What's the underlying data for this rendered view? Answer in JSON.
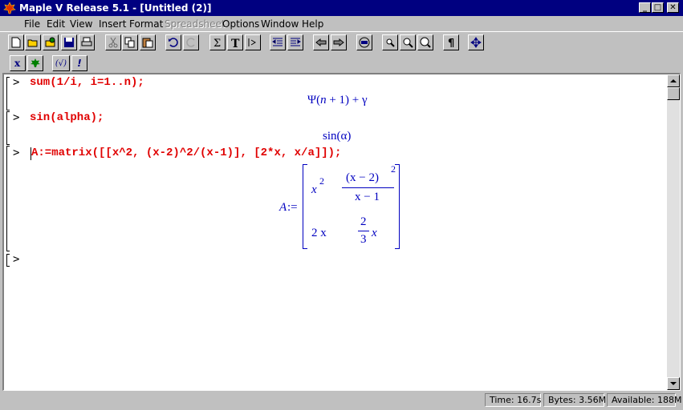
{
  "window": {
    "title": "Maple V Release 5.1 - [Untitled (2)]"
  },
  "menu": [
    {
      "label": "File",
      "disabled": false
    },
    {
      "label": "Edit",
      "disabled": false
    },
    {
      "label": "View",
      "disabled": false
    },
    {
      "label": "Insert",
      "disabled": false
    },
    {
      "label": "Format",
      "disabled": false
    },
    {
      "label": "Spreadsheet",
      "disabled": true
    },
    {
      "label": "Options",
      "disabled": false
    },
    {
      "label": "Window",
      "disabled": false
    },
    {
      "label": "Help",
      "disabled": false
    }
  ],
  "toolbar2": {
    "sqrt_label": "(√)",
    "exec_label": "!"
  },
  "worksheet": {
    "inputs": [
      "sum(1/i, i=1..n);",
      "sin(alpha);",
      "A:=matrix([[x^2, (x-2)^2/(x-1)], [2*x, x/a]]);"
    ],
    "prompt": ">",
    "output1": {
      "psi": "Ψ",
      "open": "(",
      "n": "n",
      "plus1": " + 1) + ",
      "gamma": "γ"
    },
    "output2": {
      "sin": "sin(",
      "alpha": "α",
      "close": ")"
    },
    "output3": {
      "lhs": "A",
      "assign": " :=",
      "a11_base": "x",
      "a11_exp": "2",
      "a12_num": "(x − 2)",
      "a12_num_exp": "2",
      "a12_den": "x − 1",
      "a21": "2 x",
      "a22_num": "2",
      "a22_den": "3",
      "a22_var": "x"
    }
  },
  "status": {
    "time": "Time:  16.7s",
    "bytes": "Bytes: 3.56M",
    "available": "Available: 188M"
  }
}
